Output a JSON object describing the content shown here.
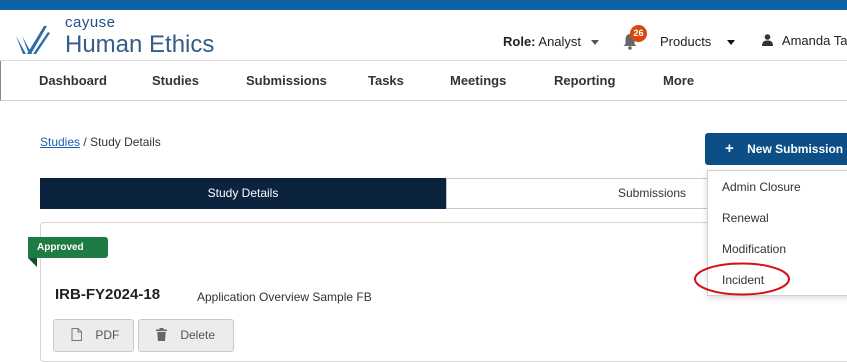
{
  "header": {
    "logo_small": "cayuse",
    "logo_big": "Human Ethics",
    "role_label": "Role:",
    "role_value": "Analyst",
    "notification_count": "26",
    "products_label": "Products",
    "user_name": "Amanda Tan"
  },
  "nav": {
    "items": [
      "Dashboard",
      "Studies",
      "Submissions",
      "Tasks",
      "Meetings",
      "Reporting",
      "More"
    ]
  },
  "breadcrumb": {
    "root": "Studies",
    "separator": "/",
    "current": "Study Details"
  },
  "actions": {
    "new_submission_label": "New Submission"
  },
  "tabs": {
    "active": "Study Details",
    "inactive": "Submissions"
  },
  "study": {
    "status": "Approved",
    "id": "IRB-FY2024-18",
    "title": "Application Overview Sample FB"
  },
  "buttons": {
    "pdf": "PDF",
    "delete": "Delete"
  },
  "dropdown": {
    "items": [
      "Admin Closure",
      "Renewal",
      "Modification",
      "Incident"
    ],
    "highlighted": "Incident"
  },
  "colors": {
    "brand_blue": "#0b62a6",
    "navy": "#0c2340",
    "button_blue": "#0b4f86",
    "approved_green": "#1e7b43",
    "badge_orange": "#d9480f",
    "highlight_red": "#d6101a"
  },
  "icons": {
    "logo": "cayuse-logo-icon",
    "notifications": "bell-icon",
    "user": "user-icon",
    "pdf": "file-icon",
    "delete": "trash-icon",
    "add": "plus-icon"
  }
}
